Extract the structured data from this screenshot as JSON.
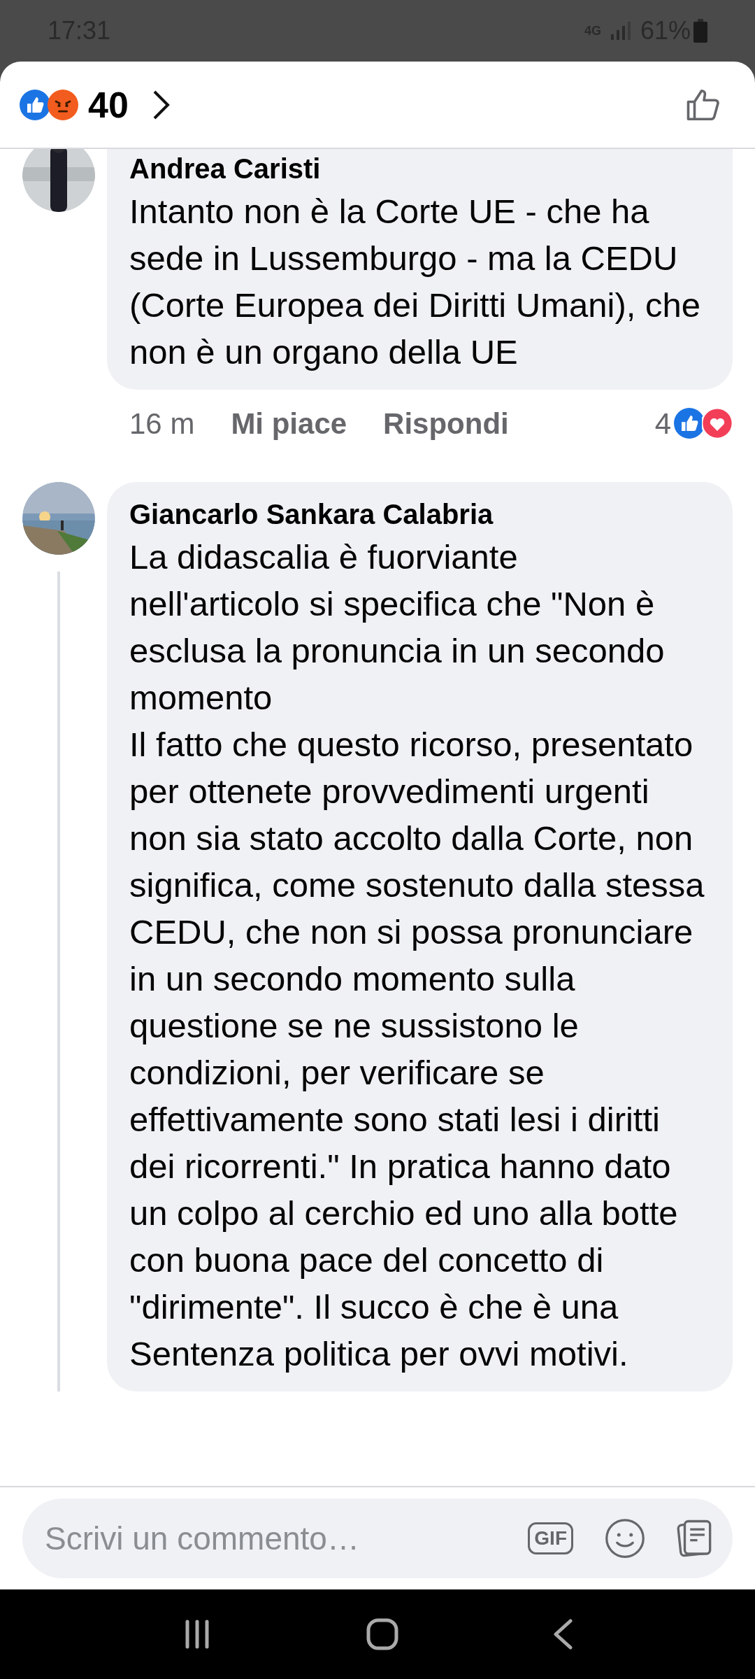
{
  "status_bar": {
    "time": "17:31",
    "network": "4G",
    "battery": "61%"
  },
  "header": {
    "reaction_count": "40"
  },
  "comments": [
    {
      "author": "Andrea Caristi",
      "text": "Intanto non è la Corte UE - che ha sede in Lussemburgo - ma la CEDU (Corte Europea dei Diritti Umani), che non è un organo della UE",
      "time": "16 m",
      "like": "Mi piace",
      "reply": "Rispondi",
      "reaction_count": "4",
      "thread": false
    },
    {
      "author": "Giancarlo Sankara Calabria",
      "text": "La didascalia è fuorviante\nnell'articolo si specifica che \"Non è esclusa la pronuncia in un secondo momento\nIl fatto che questo ricorso, presentato per ottenete provvedimenti urgenti non sia stato accolto dalla Corte, non significa, come sostenuto dalla stessa CEDU, che non si possa pronunciare in un secondo momento sulla questione se ne sussistono le condizioni, per verificare se effettivamente sono stati lesi i diritti dei ricorrenti.\" In pratica hanno dato un colpo al cerchio ed uno alla botte con buona pace del concetto di \"dirimente\". Il succo è che è una Sentenza politica per ovvi motivi.",
      "thread": true
    }
  ],
  "composer": {
    "placeholder": "Scrivi un commento…",
    "gif": "GIF"
  }
}
